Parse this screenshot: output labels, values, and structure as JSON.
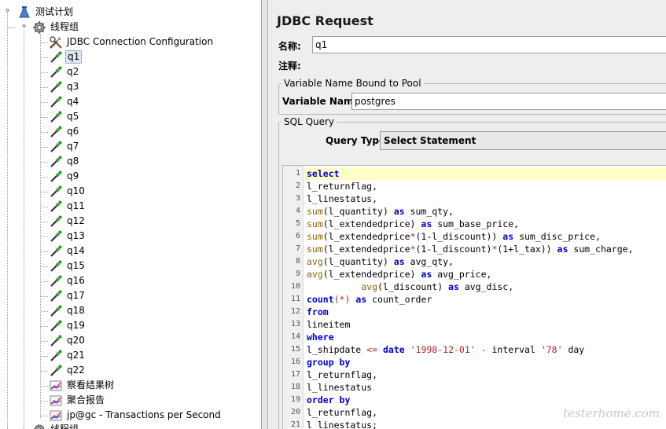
{
  "tree": {
    "root": {
      "label": "测试计划",
      "icon": "test-plan-flask-icon"
    },
    "group": {
      "label": "线程组",
      "icon": "thread-group-gear-icon"
    },
    "config": {
      "label": "JDBC Connection Configuration",
      "icon": "wrench-screwdriver-icon"
    },
    "samplers": [
      "q1",
      "q2",
      "q3",
      "q4",
      "q5",
      "q6",
      "q7",
      "q8",
      "q9",
      "q10",
      "q11",
      "q12",
      "q13",
      "q14",
      "q15",
      "q16",
      "q17",
      "q18",
      "q19",
      "q20",
      "q21",
      "q22"
    ],
    "selected": "q1",
    "sampler_icon": "pipette-sampler-icon",
    "listeners": [
      {
        "label": "察看结果树",
        "icon": "listener-graph-icon"
      },
      {
        "label": "聚合报告",
        "icon": "listener-graph-icon"
      },
      {
        "label": "jp@gc - Transactions per Second",
        "icon": "listener-graph-icon"
      }
    ],
    "next_group": {
      "label": "线程组"
    }
  },
  "panel": {
    "title": "JDBC Request",
    "name_label": "名称:",
    "name_value": "q1",
    "comment_label": "注释:",
    "pool_group_title": "Variable Name Bound to Pool",
    "var_label": "Variable Name:",
    "var_value": "postgres",
    "sql_group_title": "SQL Query",
    "query_type_label": "Query Type:",
    "query_type_value": "Select Statement",
    "highlight_color": "#ffffc8"
  },
  "sql": {
    "lines": [
      [
        [
          "kw",
          "select"
        ]
      ],
      [
        [
          "t",
          "l_returnflag,"
        ]
      ],
      [
        [
          "t",
          "l_linestatus,"
        ]
      ],
      [
        [
          "fn",
          "sum"
        ],
        [
          "t",
          "(l_quantity) "
        ],
        [
          "kw",
          "as"
        ],
        [
          "t",
          " sum_qty,"
        ]
      ],
      [
        [
          "fn",
          "sum"
        ],
        [
          "t",
          "(l_extendedprice) "
        ],
        [
          "kw",
          "as"
        ],
        [
          "t",
          " sum_base_price,"
        ]
      ],
      [
        [
          "fn",
          "sum"
        ],
        [
          "t",
          "(l_extendedprice"
        ],
        [
          "op",
          "*"
        ],
        [
          "t",
          "(1-l_discount)) "
        ],
        [
          "kw",
          "as"
        ],
        [
          "t",
          " sum_disc_price,"
        ]
      ],
      [
        [
          "fn",
          "sum"
        ],
        [
          "t",
          "(l_extendedprice"
        ],
        [
          "op",
          "*"
        ],
        [
          "t",
          "(1-l_discount)"
        ],
        [
          "op",
          "*"
        ],
        [
          "t",
          "(1+l_tax)) "
        ],
        [
          "kw",
          "as"
        ],
        [
          "t",
          " sum_charge,"
        ]
      ],
      [
        [
          "fn",
          "avg"
        ],
        [
          "t",
          "(l_quantity) "
        ],
        [
          "kw",
          "as"
        ],
        [
          "t",
          " avg_qty,"
        ]
      ],
      [
        [
          "fn",
          "avg"
        ],
        [
          "t",
          "(l_extendedprice) "
        ],
        [
          "kw",
          "as"
        ],
        [
          "t",
          " avg_price,"
        ]
      ],
      [
        [
          "t",
          "          "
        ],
        [
          "fn",
          "avg"
        ],
        [
          "t",
          "(l_discount) "
        ],
        [
          "kw",
          "as"
        ],
        [
          "t",
          " avg_disc,"
        ]
      ],
      [
        [
          "kw",
          "count"
        ],
        [
          "op",
          "(*)"
        ],
        [
          "t",
          " "
        ],
        [
          "kw",
          "as"
        ],
        [
          "t",
          " count_order"
        ]
      ],
      [
        [
          "kw",
          "from"
        ]
      ],
      [
        [
          "t",
          "lineitem"
        ]
      ],
      [
        [
          "kw",
          "where"
        ]
      ],
      [
        [
          "t",
          "l_shipdate "
        ],
        [
          "op",
          "<="
        ],
        [
          "t",
          " "
        ],
        [
          "kw",
          "date"
        ],
        [
          "t",
          " "
        ],
        [
          "str",
          "'1998-12-01'"
        ],
        [
          "t",
          " "
        ],
        [
          "op",
          "-"
        ],
        [
          "t",
          " interval "
        ],
        [
          "str",
          "'78'"
        ],
        [
          "t",
          " day"
        ]
      ],
      [
        [
          "kw",
          "group by"
        ]
      ],
      [
        [
          "t",
          "l_returnflag,"
        ]
      ],
      [
        [
          "t",
          "l_linestatus"
        ]
      ],
      [
        [
          "kw",
          "order by"
        ]
      ],
      [
        [
          "t",
          "l_returnflag,"
        ]
      ],
      [
        [
          "t",
          "l_linestatus;"
        ]
      ]
    ]
  },
  "watermark": "testerhome.com"
}
